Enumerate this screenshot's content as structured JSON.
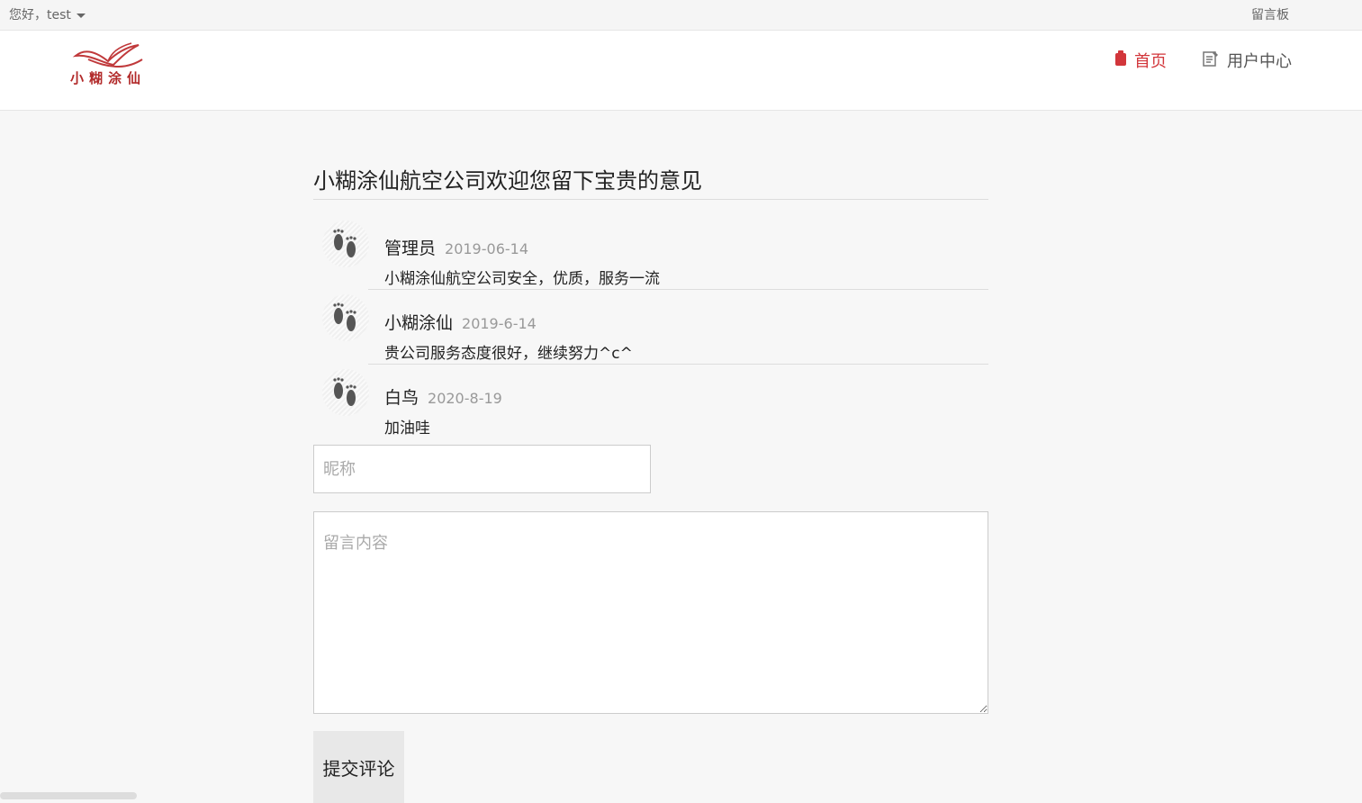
{
  "topbar": {
    "greeting": "您好，test",
    "board_link": "留言板"
  },
  "header": {
    "logo_text": "小糊涂仙",
    "nav": [
      {
        "label": "首页",
        "active": true,
        "icon": "bookmark-icon"
      },
      {
        "label": "用户中心",
        "active": false,
        "icon": "notes-edit-icon"
      }
    ]
  },
  "page_title": "小糊涂仙航空公司欢迎您留下宝贵的意见",
  "comments": [
    {
      "name": "管理员",
      "date": "2019-06-14",
      "text": "小糊涂仙航空公司安全，优质，服务一流",
      "avatar_icon": "footprints-icon"
    },
    {
      "name": "小糊涂仙",
      "date": "2019-6-14",
      "text": "贵公司服务态度很好，继续努力^c^",
      "avatar_icon": "footprints-icon"
    },
    {
      "name": "白鸟",
      "date": "2020-8-19",
      "text": "加油哇",
      "avatar_icon": "footprints-icon"
    }
  ],
  "form": {
    "nickname_placeholder": "昵称",
    "message_placeholder": "留言内容",
    "submit_label": "提交评论"
  },
  "colors": {
    "accent": "#d2363b",
    "page_bg": "#f7f7f7"
  }
}
